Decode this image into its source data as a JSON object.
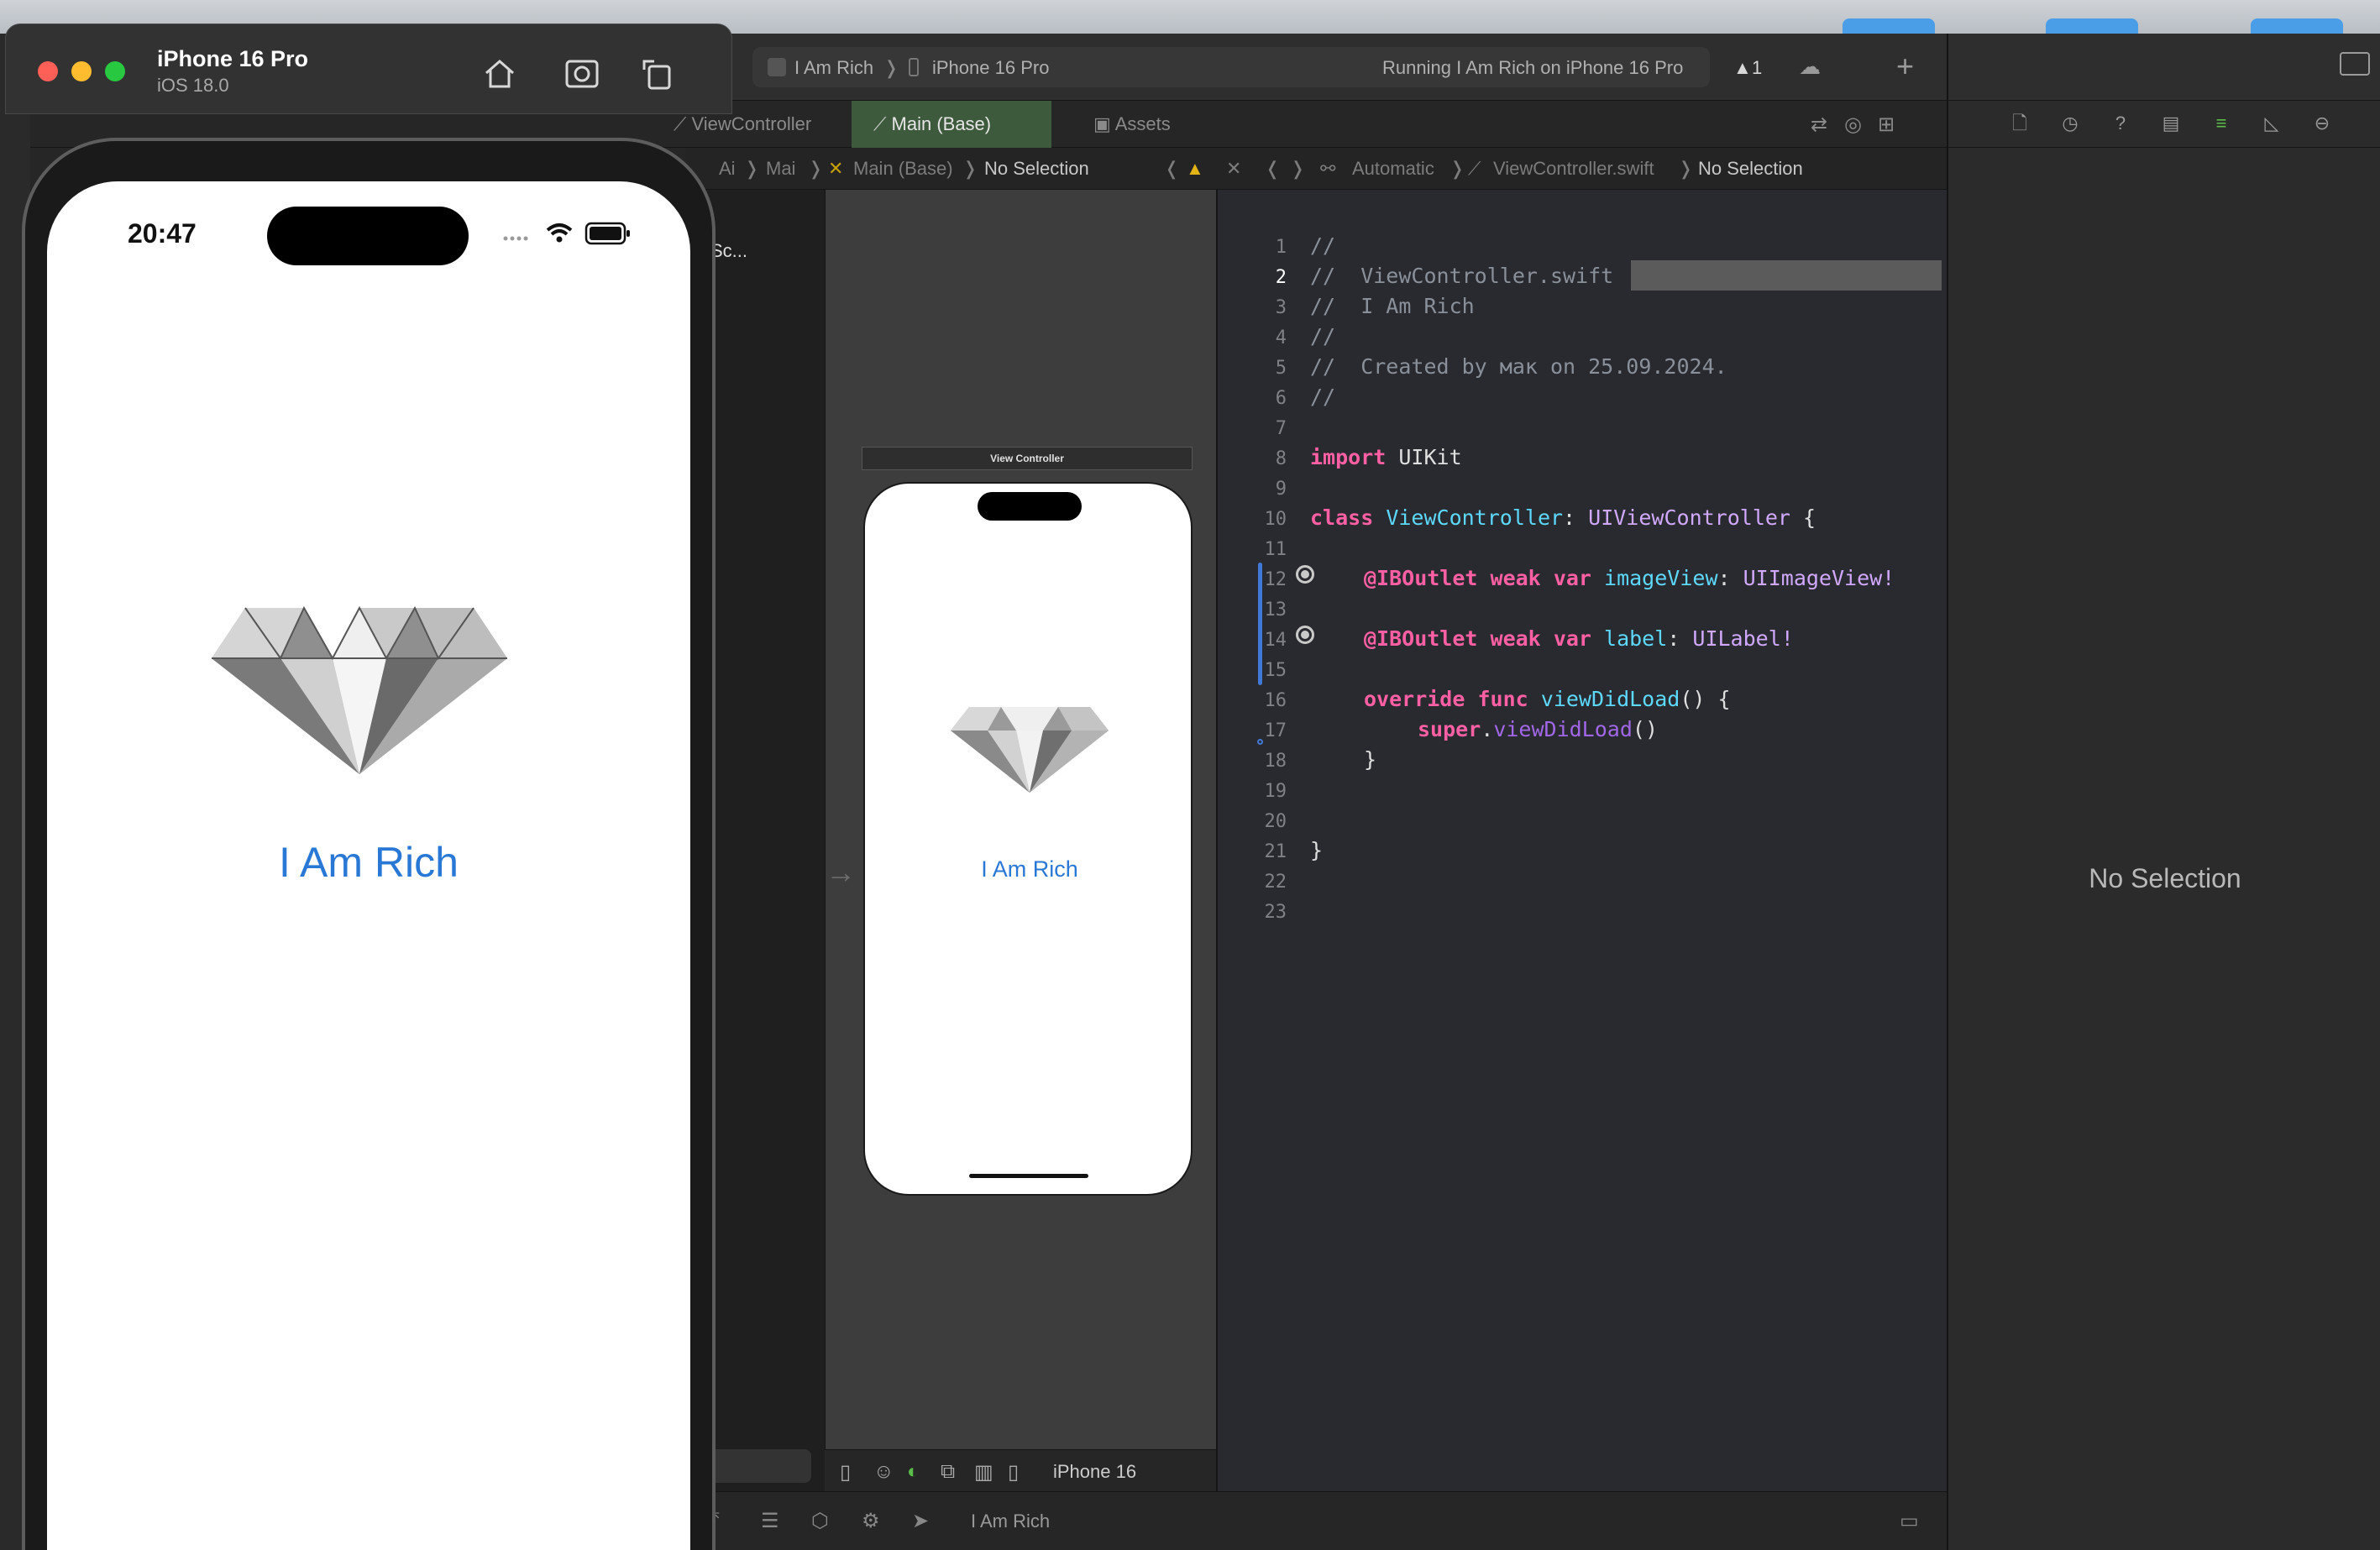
{
  "simulator": {
    "device_name": "iPhone 16 Pro",
    "os_version": "iOS 18.0",
    "status_time": "20:47",
    "app_label": "I Am Rich"
  },
  "toolbar": {
    "scheme": "I Am Rich",
    "destination": "iPhone 16 Pro",
    "status": "Running I Am Rich on iPhone 16 Pro",
    "warnings": "1"
  },
  "tabs": [
    {
      "label": "ViewController"
    },
    {
      "label": "Main (Base)"
    },
    {
      "label": "Assets"
    }
  ],
  "ib_jumpbar": {
    "p1": "Ai",
    "p2": "Mai",
    "p3": "Main (Base)",
    "p4": "No Selection"
  },
  "outline": {
    "scene_label": "Sc..."
  },
  "storyboard": {
    "scene_title": "View Controller",
    "label": "I Am Rich",
    "device": "iPhone 16"
  },
  "code_jumpbar": {
    "mode": "Automatic",
    "file": "ViewController.swift",
    "selection": "No Selection"
  },
  "code": {
    "line_numbers": [
      "1",
      "2",
      "3",
      "4",
      "5",
      "6",
      "7",
      "8",
      "9",
      "10",
      "11",
      "12",
      "13",
      "14",
      "15",
      "16",
      "17",
      "18",
      "19",
      "20",
      "21",
      "22",
      "23"
    ],
    "l1": "//",
    "l2": "//  ViewController.swift",
    "l3": "//  I Am Rich",
    "l4": "//",
    "l5": "//  Created by мак on 25.09.2024.",
    "l6": "//",
    "kw_import": "import",
    "uikit": "UIKit",
    "kw_class": "class",
    "cls_name": "ViewController",
    "superclass": "UIViewController",
    "brace_open": " {",
    "kw_iboutlet": "@IBOutlet",
    "kw_weak": "weak",
    "kw_var": "var",
    "var_image": "imageView",
    "type_image": "UIImageView!",
    "var_label": "label",
    "type_label": "UILabel!",
    "kw_override": "override",
    "kw_func": "func",
    "fn_name": "viewDidLoad",
    "paren_brace": "() {",
    "kw_super": "super",
    "call": "viewDidLoad",
    "parens": "()",
    "close_inner": "}",
    "close_outer": "}"
  },
  "bottom_status": {
    "app": "I Am Rich"
  },
  "inspector": {
    "empty_text": "No Selection"
  },
  "colors": {
    "accent_blue": "#2a78d6",
    "keyword_pink": "#fc5fa3",
    "type_cyan": "#5dd8ff",
    "active_tab_green": "#3d5a3c"
  }
}
